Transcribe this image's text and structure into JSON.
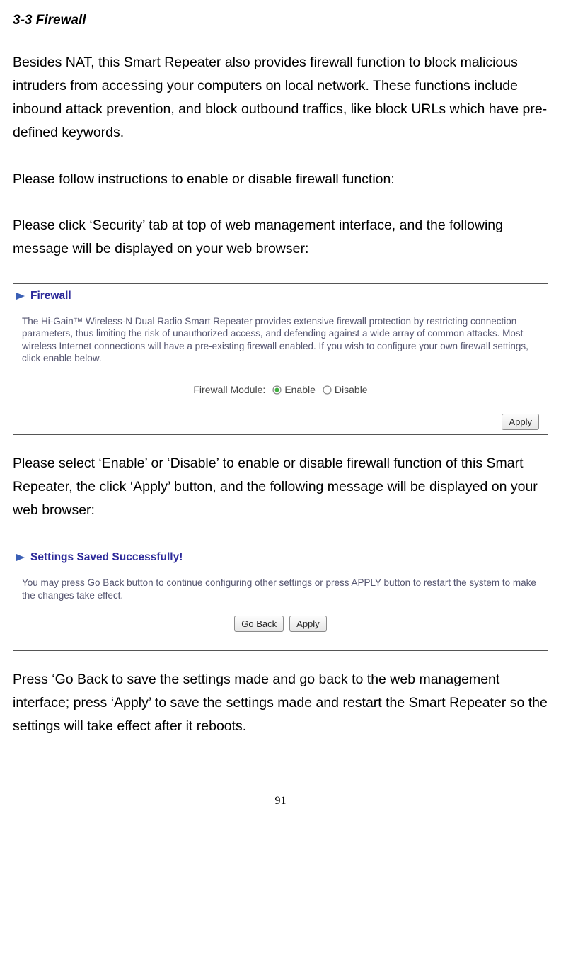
{
  "section_title": "3-3 Firewall",
  "para_intro": "Besides NAT, this Smart Repeater also provides firewall function to block malicious intruders from accessing your computers on local network. These functions include inbound attack prevention, and block outbound traffics, like block URLs which have pre-defined keywords.",
  "para_follow": "Please follow instructions to enable or disable firewall function:",
  "para_click": "Please click ‘Security’ tab at top of web management interface, and the following message will be displayed on your web browser:",
  "panel1": {
    "title": "Firewall",
    "body": "The Hi-Gain™ Wireless-N Dual Radio Smart Repeater provides extensive firewall protection by restricting connection parameters, thus limiting the risk of unauthorized access, and defending against a wide array of common attacks. Most wireless Internet connections will have a pre-existing firewall enabled. If you wish to configure your own firewall settings, click enable below.",
    "firewall_module_label": "Firewall Module:",
    "enable_label": "Enable",
    "disable_label": "Disable",
    "apply_label": "Apply"
  },
  "para_select": "Please select ‘Enable’ or ‘Disable’ to enable or disable firewall function of this Smart Repeater, the click ‘Apply’ button, and the following message will be displayed on your web browser:",
  "panel2": {
    "title": "Settings Saved Successfully!",
    "body": "You may press Go Back button to continue configuring other settings or press APPLY button to restart the system to make the changes take effect.",
    "goback_label": "Go Back",
    "apply_label": "Apply"
  },
  "para_press": "Press ‘Go Back to save the settings made and go back to the web management interface; press ‘Apply’ to save the settings made and restart the Smart Repeater so the settings will take effect after it reboots.",
  "page_number": "91"
}
